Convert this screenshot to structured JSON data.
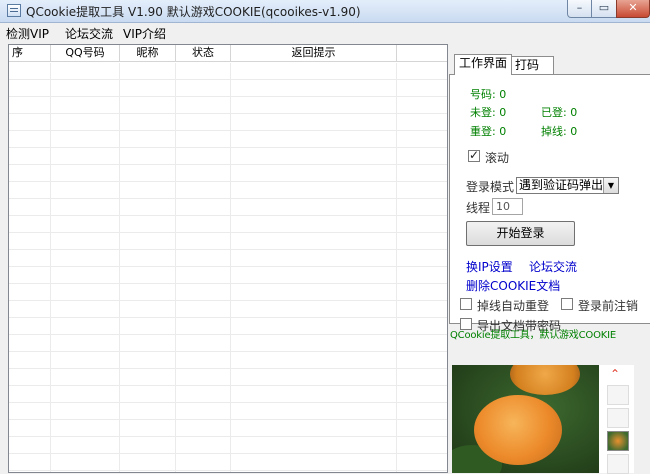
{
  "window": {
    "title": "QCookie提取工具 V1.90 默认游戏COOKIE(qcooikes-v1.90)",
    "buttons": {
      "minimize": "–",
      "maximize": "▭",
      "close": "✕"
    }
  },
  "menu": [
    "检测VIP",
    "论坛交流",
    "VIP介绍"
  ],
  "list": {
    "columns": [
      "序",
      "QQ号码",
      "昵称",
      "状态",
      "返回提示"
    ]
  },
  "tabs": [
    "工作界面",
    "打码"
  ],
  "stats": {
    "qq_label": "号码: 0",
    "not_logged": "未登: 0",
    "logged": "已登: 0",
    "relogin": "重登: 0",
    "dropped": "掉线: 0"
  },
  "scroll_check": {
    "label": "滚动",
    "checked": true
  },
  "login_mode": {
    "label": "登录模式",
    "value": "遇到验证码弹出"
  },
  "threads": {
    "label": "线程",
    "value": "10"
  },
  "start_button": "开始登录",
  "links": {
    "change_ip": "换IP设置",
    "forum": "论坛交流",
    "delete_cookie": "删除COOKIE文档"
  },
  "options": [
    {
      "label": "掉线自动重登",
      "checked": false
    },
    {
      "label": "登录前注销",
      "checked": false
    },
    {
      "label": "导出文档带密码",
      "checked": false
    }
  ],
  "ad_text": "QCookie提取工具，默认游戏COOKIE",
  "icons": {
    "app": "app-window-icon",
    "thumb_up": "chevron-up-icon"
  },
  "colors": {
    "stat_green": "#008000",
    "link_blue": "#0000cc"
  }
}
